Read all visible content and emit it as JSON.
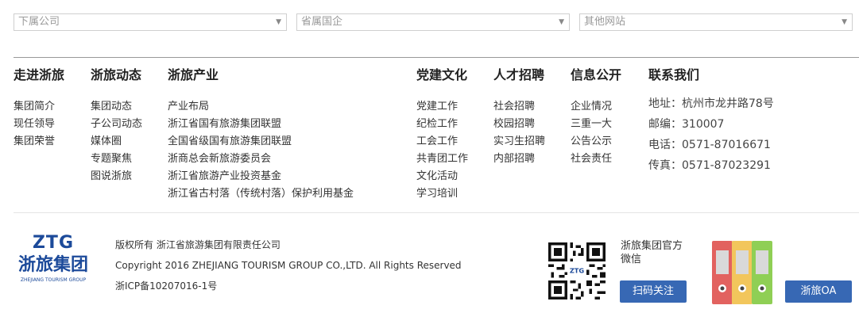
{
  "selects": [
    {
      "placeholder": "下属公司"
    },
    {
      "placeholder": "省属国企"
    },
    {
      "placeholder": "其他网站"
    }
  ],
  "nav": [
    {
      "title": "走进浙旅",
      "items": [
        "集团简介",
        "现任领导",
        "集团荣誉"
      ]
    },
    {
      "title": "浙旅动态",
      "items": [
        "集团动态",
        "子公司动态",
        "媒体圈",
        "专题聚焦",
        "图说浙旅"
      ]
    },
    {
      "title": "浙旅产业",
      "items": [
        "产业布局",
        "浙江省国有旅游集团联盟",
        "全国省级国有旅游集团联盟",
        "浙商总会新旅游委员会",
        "浙江省旅游产业投资基金",
        "浙江省古村落（传统村落）保护利用基金"
      ]
    },
    {
      "title": "党建文化",
      "items": [
        "党建工作",
        "纪检工作",
        "工会工作",
        "共青团工作",
        "文化活动",
        "学习培训"
      ]
    },
    {
      "title": "人才招聘",
      "items": [
        "社会招聘",
        "校园招聘",
        "实习生招聘",
        "内部招聘"
      ]
    },
    {
      "title": "信息公开",
      "items": [
        "企业情况",
        "三重一大",
        "公告公示",
        "社会责任"
      ]
    }
  ],
  "contact": {
    "title": "联系我们",
    "items": [
      "地址：杭州市龙井路78号",
      "邮编：310007",
      "电话：0571-87016671",
      "传真：0571-87023291"
    ]
  },
  "logo": {
    "brand": "ZTG",
    "cn": "浙旅集团",
    "en": "ZHEJIANG TOURISM GROUP"
  },
  "copyright": [
    "版权所有 浙江省旅游集团有限责任公司",
    "Copyright 2016 ZHEJIANG TOURISM GROUP CO.,LTD. All Rights Reserved",
    "浙ICP备10207016-1号"
  ],
  "wechat": {
    "line1": "浙旅集团官方",
    "line2": "微信",
    "button": "扫码关注"
  },
  "oa": {
    "button": "浙旅OA"
  },
  "colors": {
    "button": "#3768b4",
    "binder_red": "#e2625f",
    "binder_yellow": "#f2c65c",
    "binder_green": "#8fcf55"
  }
}
